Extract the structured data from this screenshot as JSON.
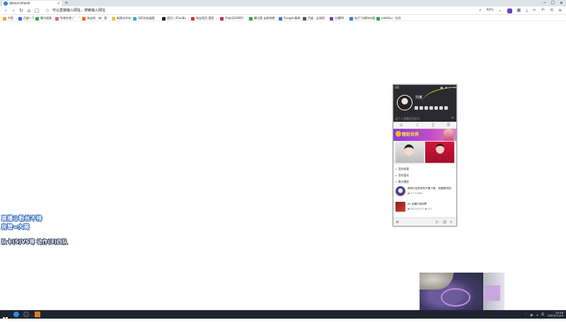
{
  "browser": {
    "tab_title": "about:blank",
    "tab_close": "×",
    "new_tab": "+",
    "window_controls": [
      "─",
      "☐",
      "✕"
    ],
    "nav_icons": [
      "back-icon",
      "refresh-icon",
      "home-icon",
      "reading-icon",
      "star-icon"
    ],
    "address_text": "可以直接输入网址",
    "search_hint": "搜索输入网址",
    "zoom": "90%"
  },
  "bookmarks": [
    {
      "label": "书签",
      "color": "#f2a33a"
    },
    {
      "label": "百度一下",
      "color": "#2a6ef0"
    },
    {
      "label": "腾讯视频",
      "color": "#2fa84f"
    },
    {
      "label": "哔哩哔哩 ( ゜- ゜)",
      "color": "#e0608a"
    },
    {
      "label": "淘宝网 - 淘！我",
      "color": "#f06a1a"
    },
    {
      "label": "新建文件夹",
      "color": "#f2c33a"
    },
    {
      "label": "360浏览器版",
      "color": "#2fb0e0"
    },
    {
      "label": "首页 | iFfonBa",
      "color": "#222222"
    },
    {
      "label": "淘宝网页 漂亮",
      "color": "#d93030"
    },
    {
      "label": "平安LEGOMO",
      "color": "#c03050"
    },
    {
      "label": "腾讯营 走斯特朗",
      "color": "#28a848"
    },
    {
      "label": "Google 翻译",
      "color": "#3a78d8"
    },
    {
      "label": "百度 · 足球网",
      "color": "#555555"
    },
    {
      "label": "主播P8",
      "color": "#6a3fc8"
    },
    {
      "label": "电子下棋Beta版",
      "color": "#3a78d8"
    },
    {
      "label": "sdefdsu · 空间",
      "color": "#2fa84f"
    }
  ],
  "overlay": {
    "line1": "直播@粉丝不排",
    "line2": "房管=大哥",
    "line3": "队卡(5)VS等 动作(3)四队"
  },
  "player": {
    "header_label": "QQ",
    "controls": [
      "▣",
      "◈",
      "─",
      "✕"
    ],
    "username": "刘某",
    "signature": "这个人很懒还没有写",
    "enter_arrow": "↵",
    "tabs": [
      "⌂",
      "♪",
      "▯",
      "☰"
    ],
    "banner_title": "精彩世界",
    "sections": [
      "我的收藏",
      "我的喜欢",
      "最近播放"
    ],
    "recent": [
      {
        "title": "请你们这样说有不要下载，电是都好的)",
        "meta": "▦ 3,712,864"
      },
      {
        "title": "09 北播打我闭界",
        "meta": "▦ 2023/10/11   ▦ 0.0"
      }
    ]
  },
  "taskbar": {
    "tray_icons": [
      "caret-up-icon",
      "network-icon",
      "volume-icon",
      "ime-icon"
    ],
    "ime": "英",
    "time": "20:16",
    "date": "2023/11/24"
  }
}
